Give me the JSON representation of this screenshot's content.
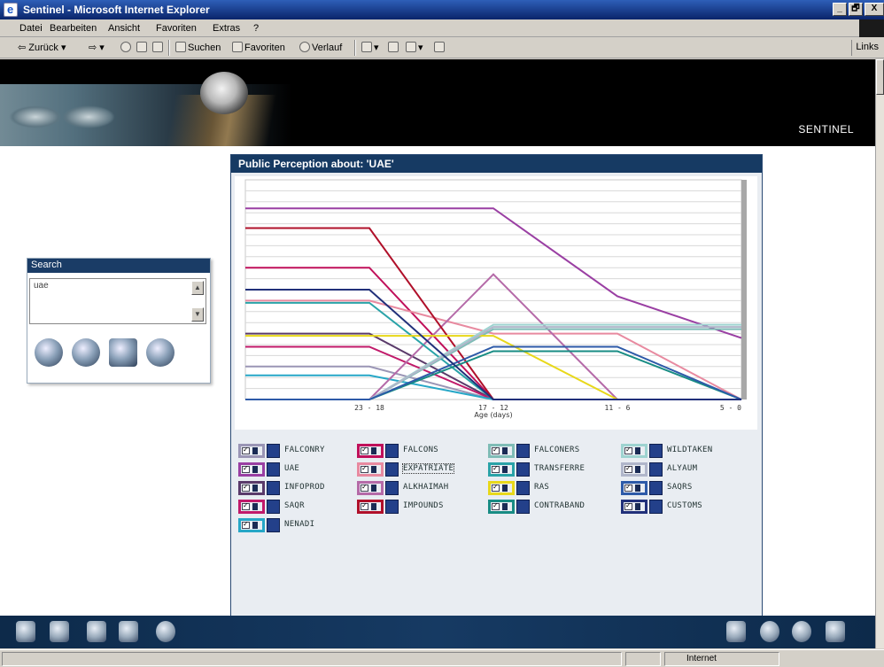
{
  "window": {
    "title": "Sentinel - Microsoft Internet Explorer",
    "controls": [
      "_",
      "🗗",
      "X"
    ]
  },
  "menu": [
    "Datei",
    "Bearbeiten",
    "Ansicht",
    "Favoriten",
    "Extras",
    "?"
  ],
  "toolbar": {
    "back": "Zurück",
    "search": "Suchen",
    "favorites": "Favoriten",
    "history": "Verlauf",
    "links": "Links"
  },
  "header": {
    "brand": "SENTINEL"
  },
  "search": {
    "title": "Search",
    "query": "uae",
    "icons": [
      "fingerprint-icon",
      "compass-icon",
      "map-icon",
      "eye-icon"
    ]
  },
  "chart": {
    "title": "Public Perception about: 'UAE'",
    "chart_data": {
      "type": "line",
      "categories": [
        "23 - 18",
        "17 - 12",
        "11 - 6",
        "5 - 0"
      ],
      "xlabel": "Age (days)",
      "ylabel": "",
      "grid": true,
      "legend_position": "bottom",
      "series": [
        {
          "name": "FALCONRY",
          "color": "#9a95b5",
          "values": [
            0.15,
            0.0,
            0.0,
            0.0
          ]
        },
        {
          "name": "UAE",
          "color": "#9a3fa3",
          "values": [
            0.87,
            0.87,
            0.47,
            0.28
          ]
        },
        {
          "name": "INFOPROD",
          "color": "#5a3a6a",
          "values": [
            0.3,
            0.0,
            0.0,
            0.0
          ]
        },
        {
          "name": "SAQR",
          "color": "#c11a6a",
          "values": [
            0.24,
            0.0,
            0.0,
            0.0
          ]
        },
        {
          "name": "NENADI",
          "color": "#26a7c7",
          "values": [
            0.11,
            0.0,
            0.0,
            0.0
          ]
        },
        {
          "name": "FALCONS",
          "color": "#c0105a",
          "values": [
            0.6,
            0.0,
            0.0,
            0.0
          ]
        },
        {
          "name": "EXPATRIATE",
          "color": "#e88aa0",
          "values": [
            0.45,
            0.3,
            0.3,
            0.0
          ]
        },
        {
          "name": "ALKHAIMAH",
          "color": "#b56aa8",
          "values": [
            0.0,
            0.57,
            0.0,
            0.0
          ]
        },
        {
          "name": "IMPOUNDS",
          "color": "#b0102a",
          "values": [
            0.78,
            0.0,
            0.0,
            0.0
          ]
        },
        {
          "name": "FALCONERS",
          "color": "#7fbcb6",
          "values": [
            0.0,
            0.32,
            0.32,
            0.32
          ]
        },
        {
          "name": "TRANSFERRE",
          "color": "#2aa3a8",
          "values": [
            0.44,
            0.0,
            0.0,
            0.0
          ]
        },
        {
          "name": "RAS",
          "color": "#e8d81a",
          "values": [
            0.29,
            0.29,
            0.0,
            0.0
          ]
        },
        {
          "name": "CONTRABAND",
          "color": "#188c84",
          "values": [
            0.0,
            0.22,
            0.22,
            0.0
          ]
        },
        {
          "name": "WILDTAKEN",
          "color": "#9ed3d0",
          "values": [
            0.0,
            0.34,
            0.34,
            0.34
          ]
        },
        {
          "name": "ALYAUM",
          "color": "#b0b6ca",
          "values": [
            0.0,
            0.33,
            0.33,
            0.33
          ]
        },
        {
          "name": "SAQRS",
          "color": "#2d5aa8",
          "values": [
            0.0,
            0.24,
            0.24,
            0.0
          ]
        },
        {
          "name": "CUSTOMS",
          "color": "#21307a",
          "values": [
            0.5,
            0.0,
            0.0,
            0.0
          ]
        }
      ],
      "legend_layout": [
        [
          "FALCONRY",
          "FALCONS",
          "FALCONERS",
          "WILDTAKEN"
        ],
        [
          "UAE",
          "EXPATRIATE",
          "TRANSFERRE",
          "ALYAUM"
        ],
        [
          "INFOPROD",
          "ALKHAIMAH",
          "RAS",
          "SAQRS"
        ],
        [
          "SAQR",
          "IMPOUNDS",
          "CONTRABAND",
          "CUSTOMS"
        ],
        [
          "NENADI"
        ]
      ]
    }
  },
  "bottombar": {
    "left_icons": [
      "person-icon",
      "document-icon",
      "book-icon",
      "gears-icon",
      "globe-icon"
    ],
    "right_icons": [
      "home-icon",
      "zoom-in-icon",
      "zoom-out-icon",
      "rocket-icon"
    ]
  },
  "status": {
    "left": "",
    "zone": "Internet"
  }
}
